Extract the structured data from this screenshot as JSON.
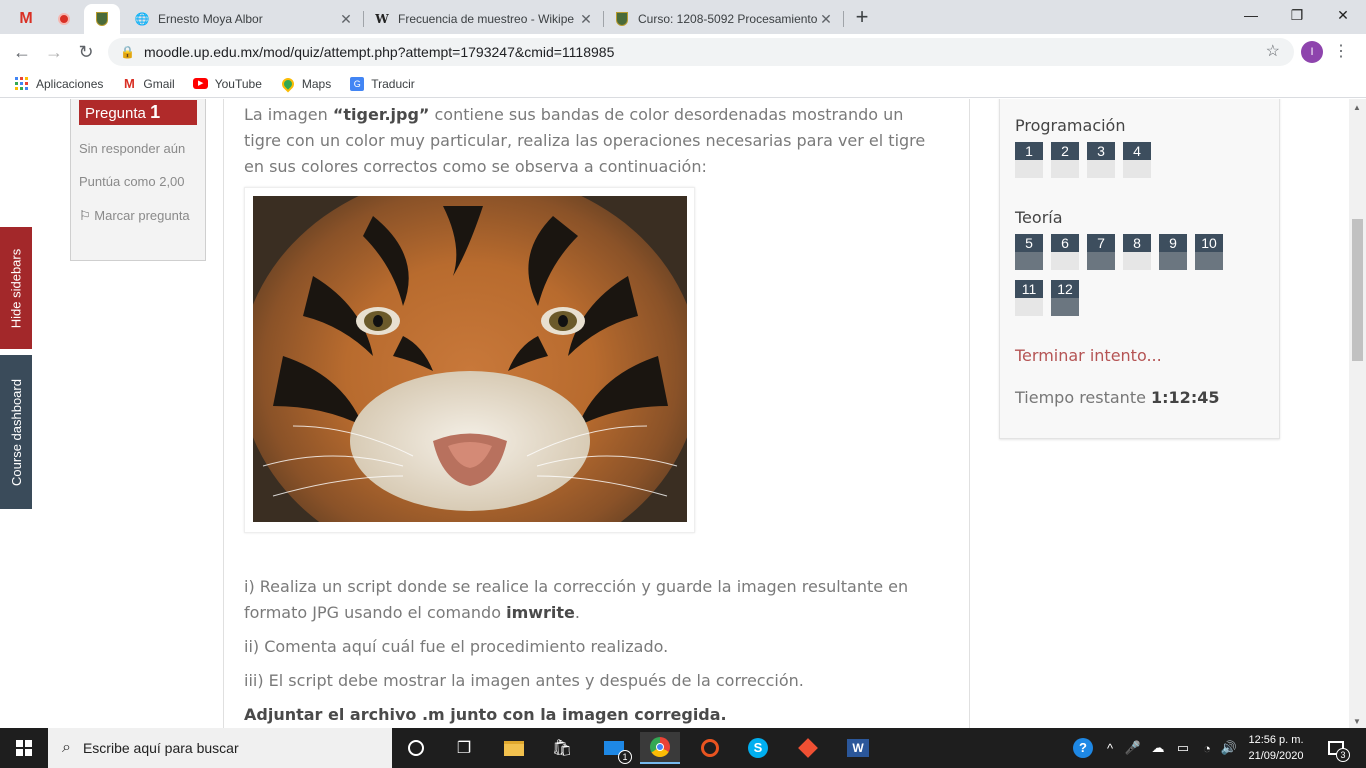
{
  "browser": {
    "tabs": [
      {
        "title": "Ernesto Moya Albor",
        "close": "✕"
      },
      {
        "title": "Frecuencia de muestreo - Wikipe",
        "close": "✕"
      },
      {
        "title": "Curso: 1208-5092 Procesamiento",
        "close": "✕"
      }
    ],
    "new_tab": "+",
    "window_controls": {
      "minimize": "—",
      "maximize": "❐",
      "close": "✕"
    },
    "url": "moodle.up.edu.mx/mod/quiz/attempt.php?attempt=1793247&cmid=1118985",
    "avatar_letter": "I",
    "bookmarks": [
      {
        "label": "Aplicaciones",
        "icon": "apps-grid-icon"
      },
      {
        "label": "Gmail",
        "icon": "gmail-icon"
      },
      {
        "label": "YouTube",
        "icon": "youtube-icon"
      },
      {
        "label": "Maps",
        "icon": "maps-icon"
      },
      {
        "label": "Traducir",
        "icon": "translate-icon"
      }
    ]
  },
  "sidebar_tabs": {
    "hide": "Hide sidebars",
    "dashboard": "Course dashboard"
  },
  "question_info": {
    "label": "Pregunta",
    "number": "1",
    "state": "Sin responder aún",
    "grade": "Puntúa como 2,00",
    "flag": "Marcar pregunta"
  },
  "question": {
    "intro_prefix": "La imagen ",
    "intro_file": "“tiger.jpg”",
    "intro_rest": " contiene sus bandas de color desordenadas mostrando un tigre con un color muy particular, realiza las operaciones necesarias para ver el tigre en sus colores correctos como se observa a continuación:",
    "item1_prefix": "i) Realiza un script donde se realice la corrección y guarde la imagen resultante en formato JPG usando el comando ",
    "item1_cmd": "imwrite",
    "item1_suffix": ".",
    "item2": "ii) Comenta aquí cuál fue el procedimiento realizado.",
    "item3": "iii) El script debe mostrar la imagen antes y después de la corrección.",
    "item4": "Adjuntar el archivo .m junto con la imagen corregida."
  },
  "quiz_nav": {
    "sections": [
      {
        "title": "Programación",
        "questions": [
          {
            "n": "1",
            "answered": false
          },
          {
            "n": "2",
            "answered": false
          },
          {
            "n": "3",
            "answered": false
          },
          {
            "n": "4",
            "answered": false
          }
        ]
      },
      {
        "title": "Teoría",
        "questions": [
          {
            "n": "5",
            "answered": true
          },
          {
            "n": "6",
            "answered": false
          },
          {
            "n": "7",
            "answered": true
          },
          {
            "n": "8",
            "answered": false
          },
          {
            "n": "9",
            "answered": true
          },
          {
            "n": "10",
            "answered": true
          },
          {
            "n": "11",
            "answered": false
          },
          {
            "n": "12",
            "answered": true
          }
        ]
      }
    ],
    "finish": "Terminar intento...",
    "timer_label": "Tiempo restante ",
    "timer_value": "1:12:45"
  },
  "taskbar": {
    "search_placeholder": "Escribe aquí para buscar",
    "mail_badge": "1",
    "time": "12:56 p. m.",
    "date": "21/09/2020",
    "notif_count": "3"
  },
  "colors": {
    "accent_red": "#a3282a",
    "dashboard_tab": "#3a4b5a",
    "nav_button": "#3d4e5e",
    "link": "#b55454"
  }
}
